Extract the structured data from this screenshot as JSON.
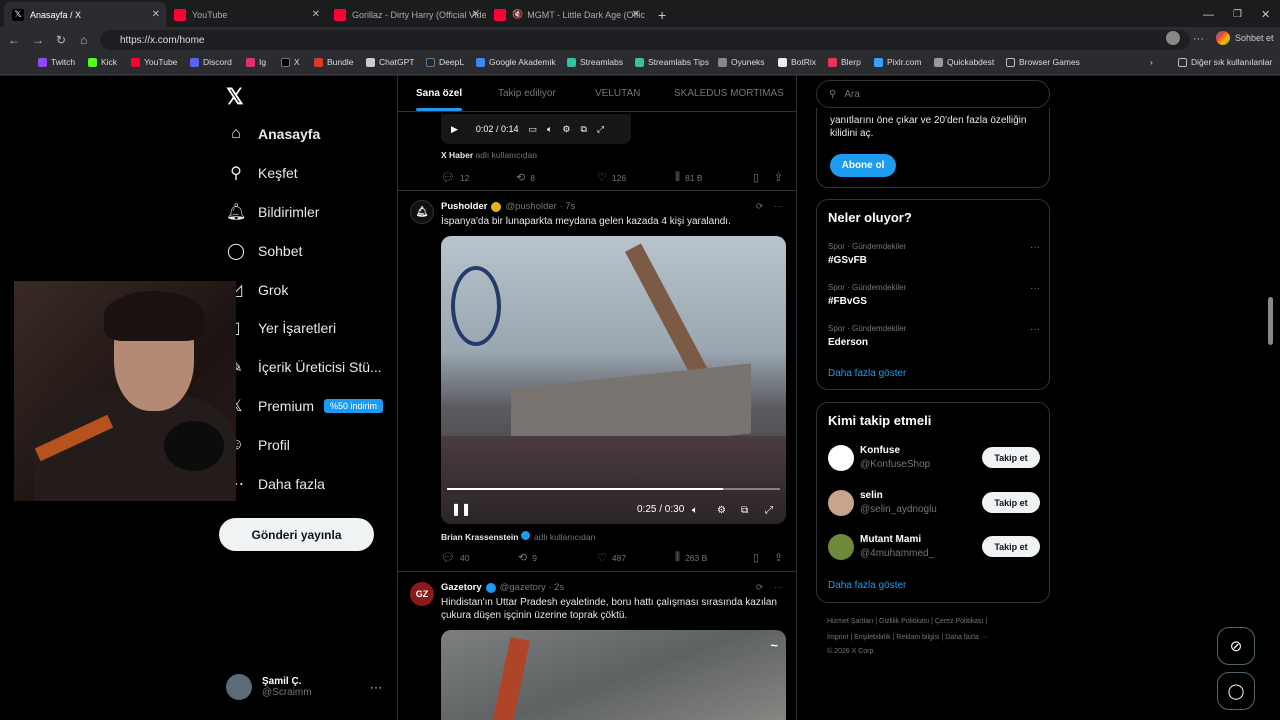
{
  "browser": {
    "tabs": [
      {
        "title": "Anasayfa / X",
        "active": true
      },
      {
        "title": "YouTube"
      },
      {
        "title": "Gorillaz - Dirty Harry (Official Vide"
      },
      {
        "title": "MGMT - Little Dark Age (Offic"
      }
    ],
    "url": "https://x.com/home",
    "profile_label": "Sohbet et",
    "bookmarks": [
      "Twitch",
      "Kick",
      "YouTube",
      "Discord",
      "Ig",
      "X",
      "Bundle",
      "ChatGPT",
      "DeepL",
      "Google Akademik",
      "Streamlabs",
      "Streamlabs Tips",
      "Oyuneks",
      "BotRix",
      "Blerp",
      "Pixlr.com",
      "Quickabdest",
      "Browser Games"
    ],
    "other_bookmarks": "Diğer sık kullanılanlar"
  },
  "sidebar": {
    "items": [
      {
        "label": "Anasayfa",
        "icon": "home-icon"
      },
      {
        "label": "Keşfet",
        "icon": "search-icon"
      },
      {
        "label": "Bildirimler",
        "icon": "bell-icon"
      },
      {
        "label": "Sohbet",
        "icon": "chat-icon"
      },
      {
        "label": "Grok",
        "icon": "grok-icon"
      },
      {
        "label": "Yer İşaretleri",
        "icon": "bookmark-icon"
      },
      {
        "label": "İçerik Üreticisi Stü...",
        "icon": "creator-icon"
      },
      {
        "label": "Premium",
        "icon": "x-icon",
        "badge": "%50 indirim"
      },
      {
        "label": "Profil",
        "icon": "user-icon"
      },
      {
        "label": "Daha fazla",
        "icon": "more-icon"
      }
    ],
    "post_button": "Gönderi yayınla",
    "user": {
      "name": "Şamil Ç.",
      "handle": "@Scraimm"
    }
  },
  "feed": {
    "tabs": [
      "Sana özel",
      "Takip ediliyor",
      "VELUTAN",
      "SKALEDUS MORTIMAS"
    ],
    "prev_tweet": {
      "video_time": "0:02 / 0:14",
      "from_account": "X Haber",
      "from_suffix": "adlı kullanıcıdan",
      "replies": "12",
      "reposts": "8",
      "likes": "126",
      "views": "81 B"
    },
    "tweet1": {
      "name": "Pusholder",
      "handle": "@pusholder · 7s",
      "text": "İspanya'da bir lunaparkta meydana gelen kazada 4 kişi yaralandı.",
      "video_time": "0:25 / 0:30",
      "video_progress": 0.83,
      "from_account": "Brian Krassenstein",
      "from_suffix": "adlı kullanıcıdan",
      "replies": "40",
      "reposts": "9",
      "likes": "487",
      "views": "263 B"
    },
    "tweet2": {
      "name": "Gazetory",
      "handle": "@gazetory · 2s",
      "avatar_text": "GZ",
      "text_line1": "Hindistan'ın Uttar Pradesh eyaletinde, boru hattı çalışması sırasında kazılan",
      "text_line2": "çukura düşen işçinin üzerine toprak çöktü."
    }
  },
  "right": {
    "search_placeholder": "Ara",
    "premium_card": {
      "line1": "yanıtlarını öne çıkar ve 20'den fazla özelliğin",
      "line2": "kilidini aç.",
      "button": "Abone ol"
    },
    "trends_title": "Neler oluyor?",
    "trends": [
      {
        "category": "Spor · Gündemdekiler",
        "name": "#GSvFB"
      },
      {
        "category": "Spor · Gündemdekiler",
        "name": "#FBvGS"
      },
      {
        "category": "Spor · Gündemdekiler",
        "name": "Ederson"
      }
    ],
    "show_more": "Daha fazla göster",
    "follow_title": "Kimi takip etmeli",
    "suggestions": [
      {
        "name": "Konfuse",
        "handle": "@KonfuseShop",
        "button": "Takip et"
      },
      {
        "name": "selin",
        "handle": "@selin_aydnoglu",
        "button": "Takip et"
      },
      {
        "name": "Mutant Mami",
        "handle": "@4muhammed_",
        "button": "Takip et"
      }
    ],
    "footer_line1": "Hizmet Şartları  |  Gizlilik Politikası  |  Çerez Politikası  |",
    "footer_line2": "İmprint  |  Erişilebilirlik  |  Reklam bilgisi  |  Daha fazla ···",
    "footer_line3": "© 2026 X Corp."
  },
  "colors": {
    "accent": "#1d9bf0",
    "background": "#000000",
    "border": "#2f3336",
    "muted": "#71767b"
  }
}
